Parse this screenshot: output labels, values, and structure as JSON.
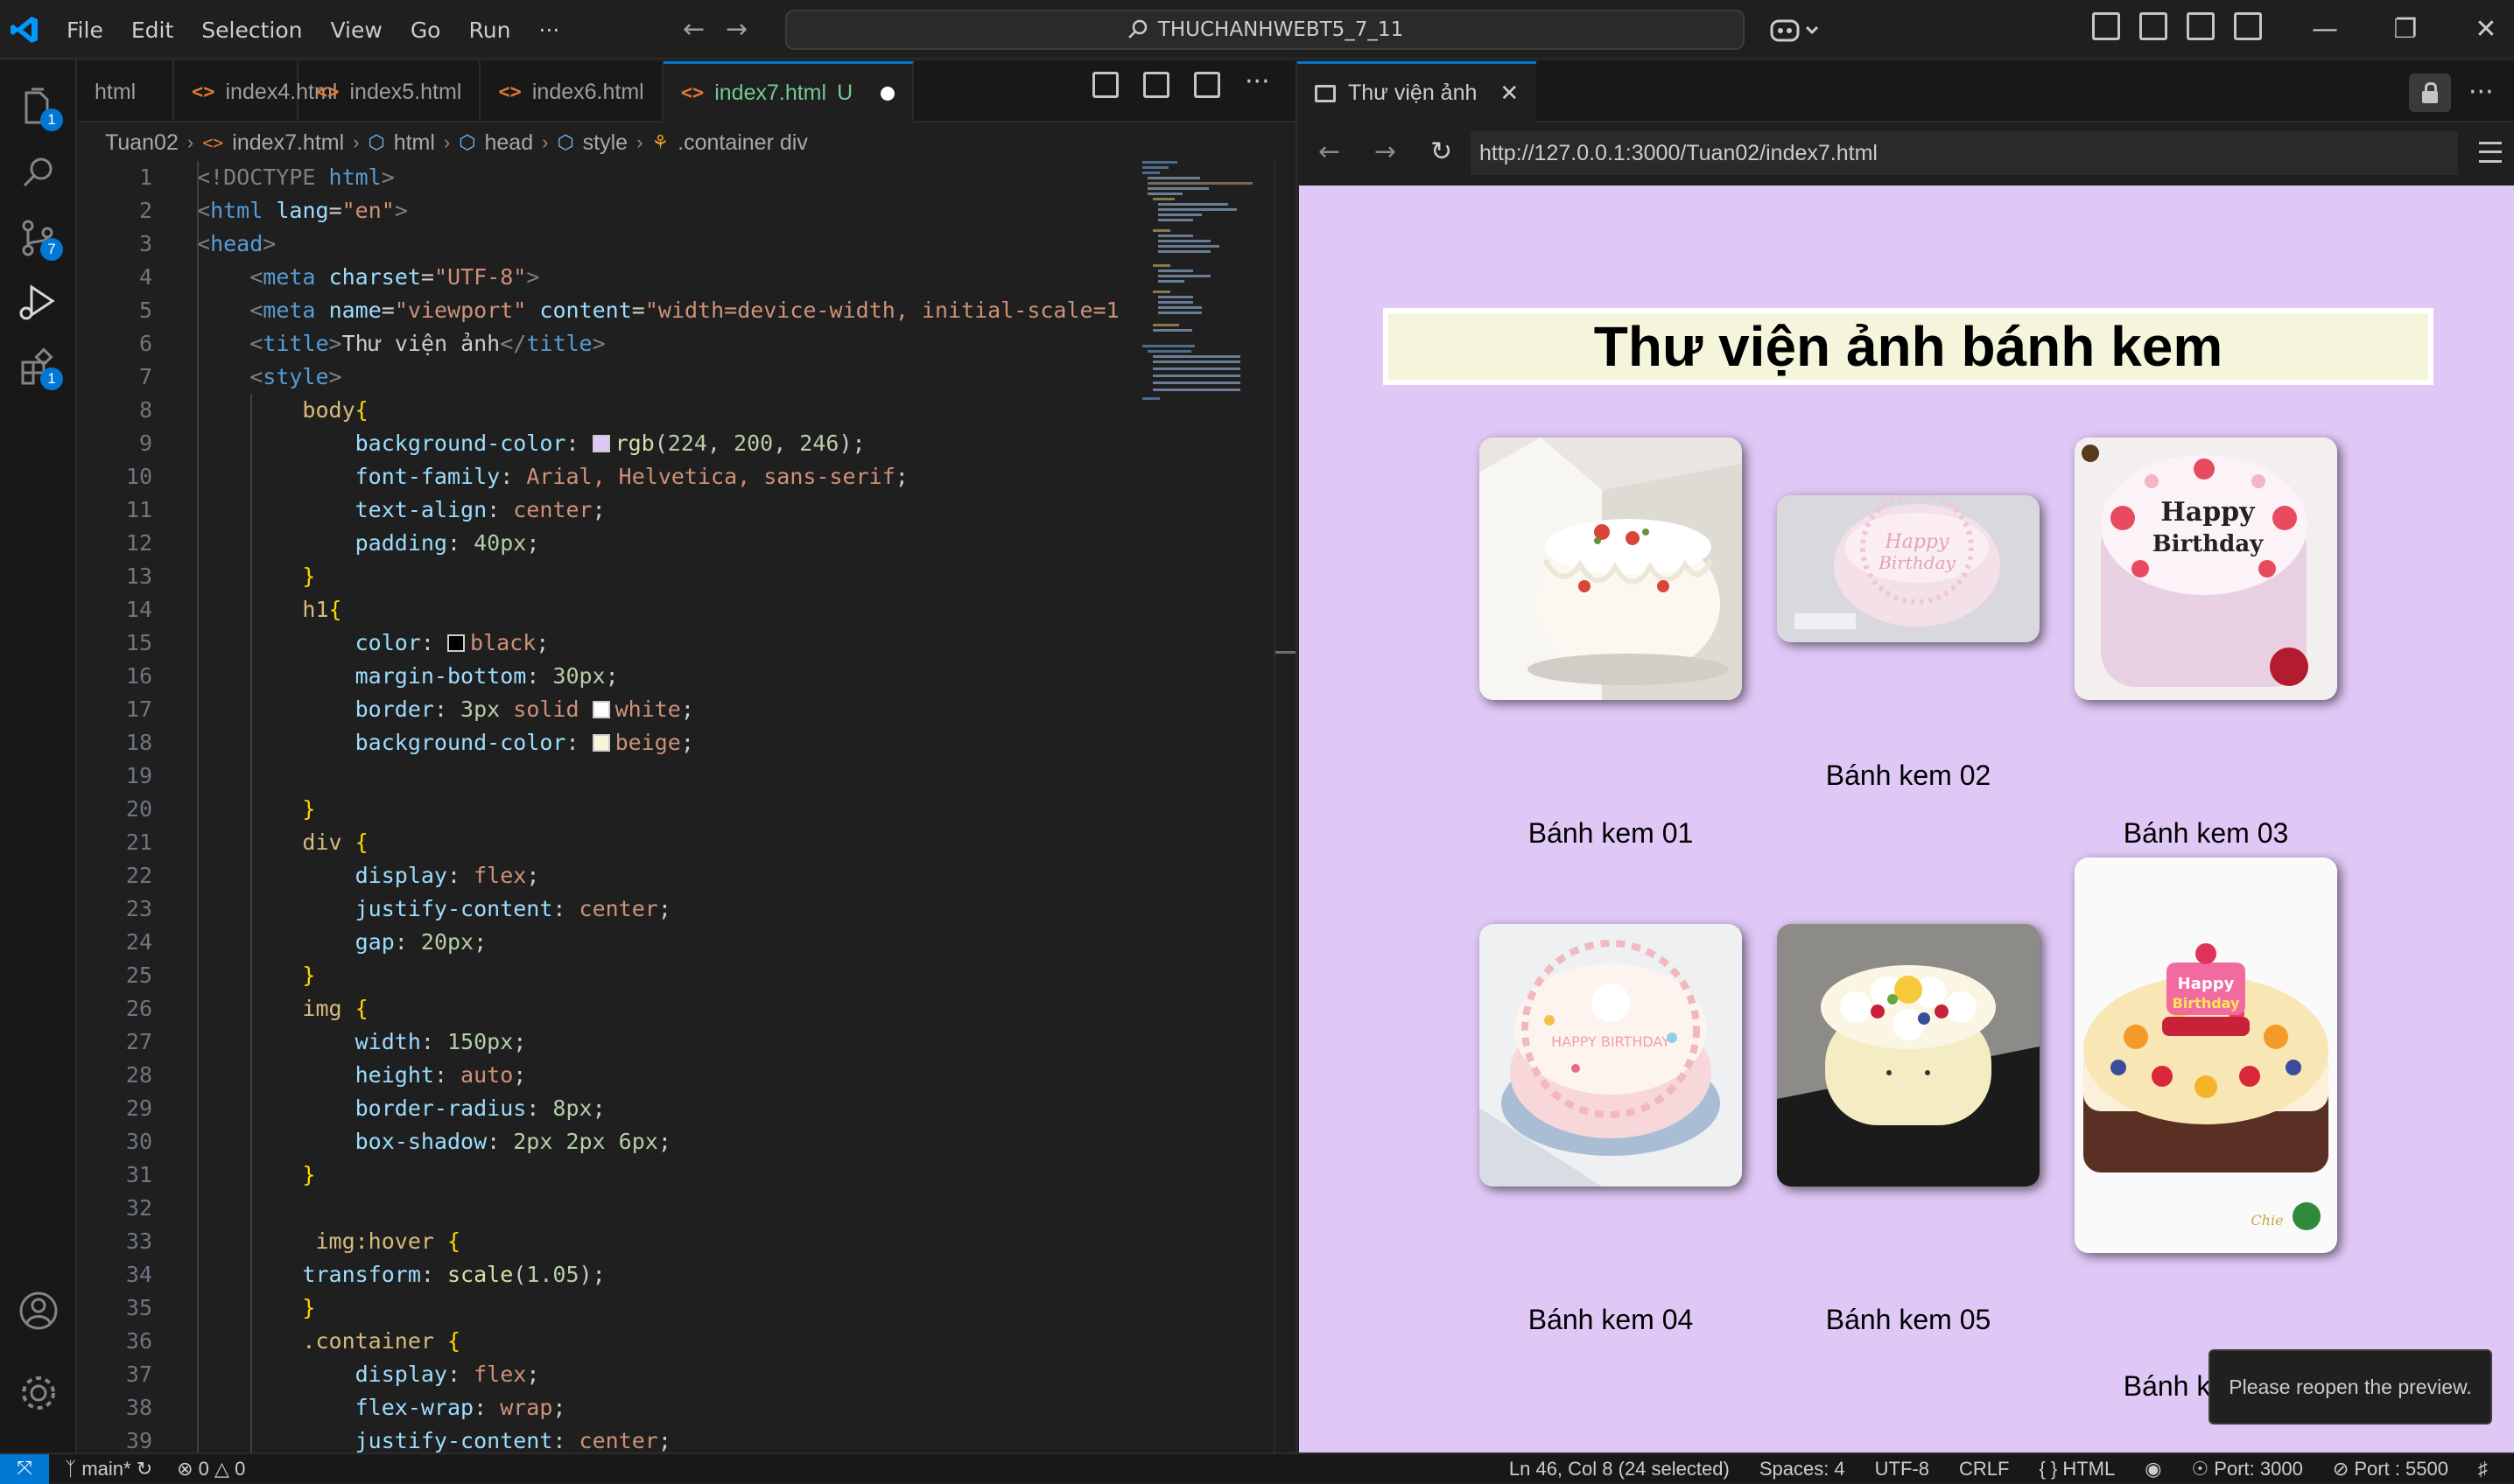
{
  "titlebar": {
    "menu": [
      "File",
      "Edit",
      "Selection",
      "View",
      "Go",
      "Run",
      "···"
    ],
    "search_text": "THUCHANHWEBT5_7_11"
  },
  "activity": {
    "explorer_badge": "1",
    "scm_badge": "7",
    "extensions_badge": "1"
  },
  "tabs": [
    {
      "label": "html"
    },
    {
      "label": "index4.html"
    },
    {
      "label": "index5.html"
    },
    {
      "label": "index6.html"
    },
    {
      "label": "index7.html",
      "status": "U"
    }
  ],
  "breadcrumb": [
    "Tuan02",
    "index7.html",
    "html",
    "head",
    "style",
    ".container div"
  ],
  "code_lines": [
    "1",
    "2",
    "3",
    "4",
    "5",
    "6",
    "7",
    "8",
    "9",
    "10",
    "11",
    "12",
    "13",
    "14",
    "15",
    "16",
    "17",
    "18",
    "19",
    "20",
    "21",
    "22",
    "23",
    "24",
    "25",
    "26",
    "27",
    "28",
    "29",
    "30",
    "31",
    "32",
    "33",
    "34",
    "35",
    "36",
    "37",
    "38",
    "39"
  ],
  "code": {
    "l1a": "<!DOCTYPE",
    "l1b": " html",
    "l1c": ">",
    "l2a": "html",
    "l2b": "lang",
    "l2c": "\"en\"",
    "l3a": "head",
    "l4a": "meta",
    "l4b": "charset",
    "l4c": "\"UTF-8\"",
    "l5a": "meta",
    "l5b": "name",
    "l5c": "\"viewport\"",
    "l5d": "content",
    "l5e": "\"width=device-width, initial-scale=1",
    "l6a": "title",
    "l6b": "Thư viện ảnh",
    "l6c": "title",
    "l7a": "style",
    "l8a": "body",
    "l9a": "background-color",
    "l9b": "rgb",
    "l9c": "224, 200, 246",
    "l10a": "font-family",
    "l10b": "Arial, Helvetica, sans-serif",
    "l11a": "text-align",
    "l11b": "center",
    "l12a": "padding",
    "l12b": "40px",
    "l14a": "h1",
    "l15a": "color",
    "l15b": "black",
    "l16a": "margin-bottom",
    "l16b": "30px",
    "l17a": "border",
    "l17b": "3px",
    "l17c": "solid",
    "l17d": "white",
    "l18a": "background-color",
    "l18b": "beige",
    "l21a": "div",
    "l22a": "display",
    "l22b": "flex",
    "l23a": "justify-content",
    "l23b": "center",
    "l24a": "gap",
    "l24b": "20px",
    "l26a": "img",
    "l27a": "width",
    "l27b": "150px",
    "l28a": "height",
    "l28b": "auto",
    "l29a": "border-radius",
    "l29b": "8px",
    "l30a": "box-shadow",
    "l30b": "2px 2px 6px",
    "l33a": "img:hover",
    "l34a": "transform",
    "l34b": "scale",
    "l34c": "1.05",
    "l36a": ".container",
    "l37a": "display",
    "l37b": "flex",
    "l38a": "flex-wrap",
    "l38b": "wrap",
    "l39a": "justify-content",
    "l39b": "center"
  },
  "preview": {
    "tab_label": "Thư viện ảnh",
    "url": "http://127.0.0.1:3000/Tuan02/index7.html",
    "heading": "Thư viện ảnh bánh kem",
    "captions": [
      "Bánh kem 01",
      "Bánh kem 02",
      "Bánh kem 03",
      "Bánh kem 04",
      "Bánh kem 05",
      "Bánh kem 06"
    ],
    "toast": "Please reopen the preview.",
    "page_bg": "#e0c8f6"
  },
  "statusbar": {
    "branch": "main*",
    "errors": "0",
    "warnings": "0",
    "cursor": "Ln 46, Col 8 (24 selected)",
    "spaces": "Spaces: 4",
    "encoding": "UTF-8",
    "eol": "CRLF",
    "language": "HTML",
    "port1": "Port: 3000",
    "port2": "Port : 5500"
  },
  "colors": {
    "accent": "#0078d4",
    "modified_tab": "#73c991",
    "editor_bg": "#1f1f1f"
  }
}
